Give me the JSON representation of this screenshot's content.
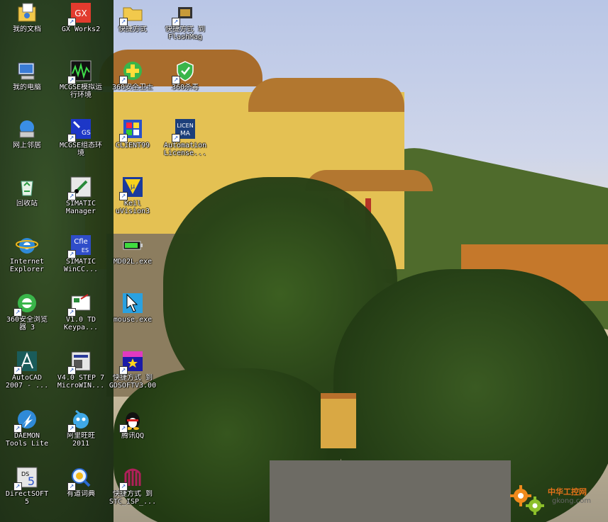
{
  "desktop": {
    "watermark": {
      "cn": "中华工控网",
      "en": "gkong.com"
    },
    "icons": [
      {
        "label": "我的文档",
        "icon": "my-documents-icon",
        "shortcut": false
      },
      {
        "label": "GX Works2",
        "icon": "gx-works2-icon",
        "shortcut": true
      },
      {
        "label": "快捷方式",
        "icon": "folder-icon",
        "shortcut": true
      },
      {
        "label": "快捷方式 到\nFlashMag",
        "icon": "chip-icon",
        "shortcut": true
      },
      {
        "label": "我的电脑",
        "icon": "my-computer-icon",
        "shortcut": false
      },
      {
        "label": "MCGSE模拟运\n行环境",
        "icon": "mcgs-simulation-icon",
        "shortcut": true
      },
      {
        "label": "360安全卫士",
        "icon": "360-safe-icon",
        "shortcut": true
      },
      {
        "label": "360杀毒",
        "icon": "360-antivirus-icon",
        "shortcut": true
      },
      {
        "label": "网上邻居",
        "icon": "network-places-icon",
        "shortcut": false
      },
      {
        "label": "MCGSE组态环\n境",
        "icon": "mcgs-config-icon",
        "shortcut": true
      },
      {
        "label": "CLIENT99",
        "icon": "client99-icon",
        "shortcut": true
      },
      {
        "label": "Automation\nLicense...",
        "icon": "license-manager-icon",
        "shortcut": true
      },
      {
        "label": "回收站",
        "icon": "recycle-bin-icon",
        "shortcut": false
      },
      {
        "label": "SIMATIC\nManager",
        "icon": "simatic-manager-icon",
        "shortcut": true
      },
      {
        "label": "Keil\nuVision3",
        "icon": "keil-uvision-icon",
        "shortcut": true
      },
      {
        "label": "Internet\nExplorer",
        "icon": "internet-explorer-icon",
        "shortcut": false
      },
      {
        "label": "SIMATIC\nWinCC...",
        "icon": "wincc-flexible-icon",
        "shortcut": true
      },
      {
        "label": "MD02L.exe",
        "icon": "battery-exe-icon",
        "shortcut": false
      },
      {
        "label": "360安全浏览\n器 3",
        "icon": "360-browser-icon",
        "shortcut": true
      },
      {
        "label": "V1.0 TD\nKeypa...",
        "icon": "td-keypad-icon",
        "shortcut": true
      },
      {
        "label": "mouse.exe",
        "icon": "mouse-exe-icon",
        "shortcut": false
      },
      {
        "label": "AutoCAD\n2007 - ...",
        "icon": "autocad-icon",
        "shortcut": true
      },
      {
        "label": "V4.0 STEP 7\nMicroWIN...",
        "icon": "step7-microwin-icon",
        "shortcut": true
      },
      {
        "label": "快捷方式 到\nGDSOFTV3.00",
        "icon": "gdsoft-icon",
        "shortcut": true
      },
      {
        "label": "DAEMON\nTools Lite",
        "icon": "daemon-tools-icon",
        "shortcut": true
      },
      {
        "label": "阿里旺旺\n2011",
        "icon": "aliwangwang-icon",
        "shortcut": true
      },
      {
        "label": "腾讯QQ",
        "icon": "qq-penguin-icon",
        "shortcut": true
      },
      {
        "label": "DirectSOFT\n5",
        "icon": "directsoft-icon",
        "shortcut": true
      },
      {
        "label": "有道词典",
        "icon": "youdao-dict-icon",
        "shortcut": true
      },
      {
        "label": "快捷方式 到\nSTC_ISP_...",
        "icon": "stc-isp-icon",
        "shortcut": true
      }
    ]
  }
}
